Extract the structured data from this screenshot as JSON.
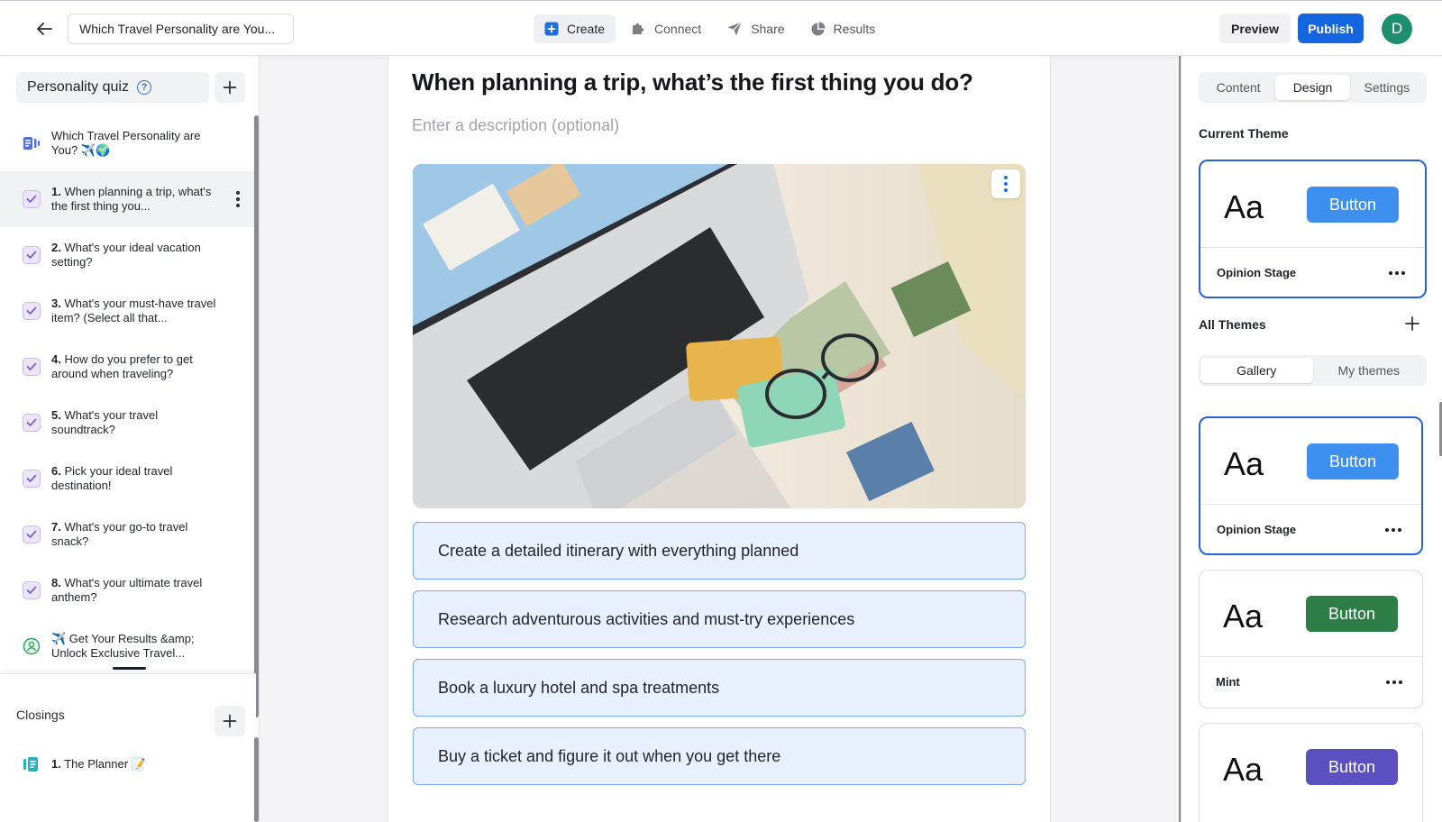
{
  "header": {
    "back_label": "Back",
    "quiz_title_value": "Which Travel Personality are You...",
    "nav": [
      {
        "label": "Create",
        "icon": "plus-square-icon",
        "active": true
      },
      {
        "label": "Connect",
        "icon": "puzzle-icon",
        "active": false
      },
      {
        "label": "Share",
        "icon": "send-icon",
        "active": false
      },
      {
        "label": "Results",
        "icon": "pie-chart-icon",
        "active": false
      }
    ],
    "preview_label": "Preview",
    "publish_label": "Publish",
    "avatar_initial": "D"
  },
  "sidebar": {
    "quiz_type": "Personality quiz",
    "help_glyph": "?",
    "intro": {
      "text": "Which Travel Personality are You? ✈️🌍",
      "icon": "intro-slide-icon"
    },
    "questions": [
      {
        "num": "1.",
        "text": "When planning a trip, what's the first thing you...",
        "selected": true
      },
      {
        "num": "2.",
        "text": "What's your ideal vacation setting?"
      },
      {
        "num": "3.",
        "text": "What's your must-have travel item? (Select all that..."
      },
      {
        "num": "4.",
        "text": "How do you prefer to get around when traveling?"
      },
      {
        "num": "5.",
        "text": "What's your travel soundtrack?"
      },
      {
        "num": "6.",
        "text": "Pick your ideal travel destination!"
      },
      {
        "num": "7.",
        "text": "What's your go-to travel snack?"
      },
      {
        "num": "8.",
        "text": "What's your ultimate travel anthem?"
      }
    ],
    "form": {
      "text": "✈️ Get Your Results &amp; Unlock Exclusive Travel...",
      "icon": "form-user-icon"
    },
    "closings_label": "Closings",
    "closings": [
      {
        "num": "1.",
        "text": "The Planner 📝"
      }
    ]
  },
  "editor": {
    "question_title": "When planning a trip, what’s the first thing you do?",
    "description_placeholder": "Enter a description (optional)",
    "image_alt": "Laptop with credit card, glasses and travel magazines",
    "answers": [
      "Create a detailed itinerary with everything planned",
      "Research adventurous activities and must-try experiences",
      "Book a luxury hotel and spa treatments",
      "Buy a ticket and figure it out when you get there"
    ]
  },
  "panel": {
    "tabs": [
      {
        "label": "Content",
        "active": false
      },
      {
        "label": "Design",
        "active": true
      },
      {
        "label": "Settings",
        "active": false
      }
    ],
    "current_theme_label": "Current Theme",
    "all_themes_label": "All Themes",
    "gallery_tabs": [
      {
        "label": "Gallery",
        "active": true
      },
      {
        "label": "My themes",
        "active": false
      }
    ],
    "current_theme": {
      "sample": "Aa",
      "button": "Button",
      "name": "Opinion Stage",
      "color": "#3d8ff0"
    },
    "themes": [
      {
        "sample": "Aa",
        "button": "Button",
        "name": "Opinion Stage",
        "color": "#3d8ff0",
        "selected": true
      },
      {
        "sample": "Aa",
        "button": "Button",
        "name": "Mint",
        "color": "#2d7d46",
        "selected": false
      },
      {
        "sample": "Aa",
        "button": "Button",
        "name": "",
        "color": "#5b4fc2",
        "selected": false
      }
    ]
  },
  "colors": {
    "accent": "#1565e0",
    "answer_bg": "#e8f1fd",
    "answer_border": "#7aa9ee",
    "avatar": "#1e8e6e",
    "question_icon": "#8b6be0"
  }
}
